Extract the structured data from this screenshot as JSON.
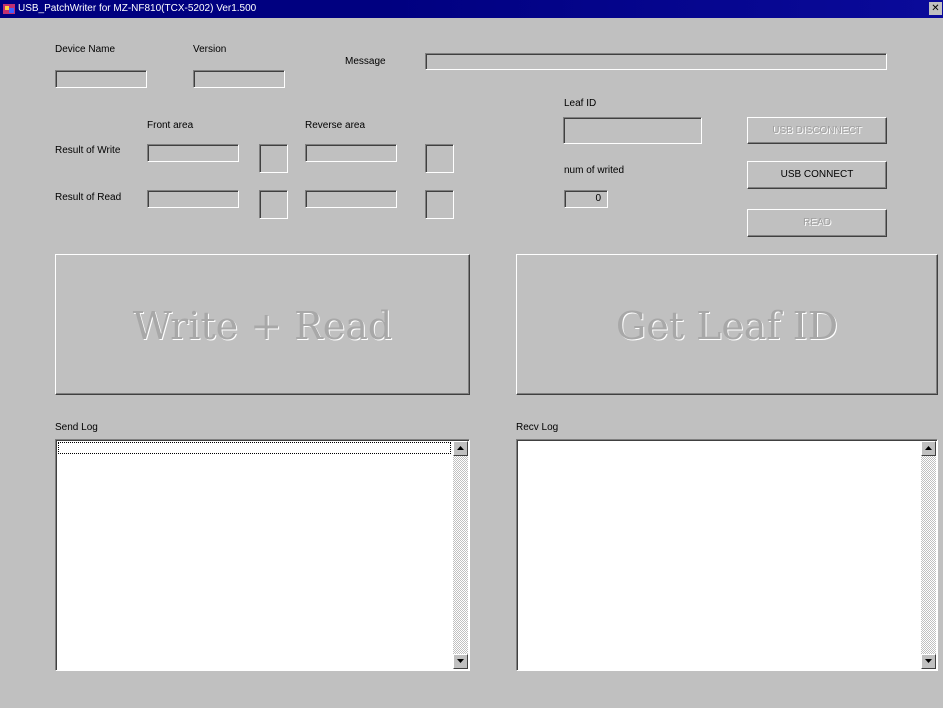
{
  "window": {
    "title": "USB_PatchWriter for MZ-NF810(TCX-5202) Ver1.500",
    "close_glyph": "✕"
  },
  "labels": {
    "device_name": "Device Name",
    "version": "Version",
    "message": "Message",
    "front_area": "Front area",
    "reverse_area": "Reverse area",
    "result_of_write": "Result of Write",
    "result_of_read": "Result of Read",
    "leaf_id": "Leaf ID",
    "num_of_writed": "num of writed",
    "send_log": "Send Log",
    "recv_log": "Recv Log"
  },
  "fields": {
    "num_of_writed_value": "0"
  },
  "buttons": {
    "usb_disconnect": "USB DISCONNECT",
    "usb_connect": "USB CONNECT",
    "read": "READ",
    "write_read": "Write + Read",
    "get_leaf_id": "Get Leaf ID"
  },
  "icons": {
    "app": "app-icon",
    "close": "close-icon",
    "scroll_up": "scroll-up-arrow-icon",
    "scroll_down": "scroll-down-arrow-icon"
  },
  "colors": {
    "titlebar": "#000080",
    "face": "#c0c0c0"
  }
}
